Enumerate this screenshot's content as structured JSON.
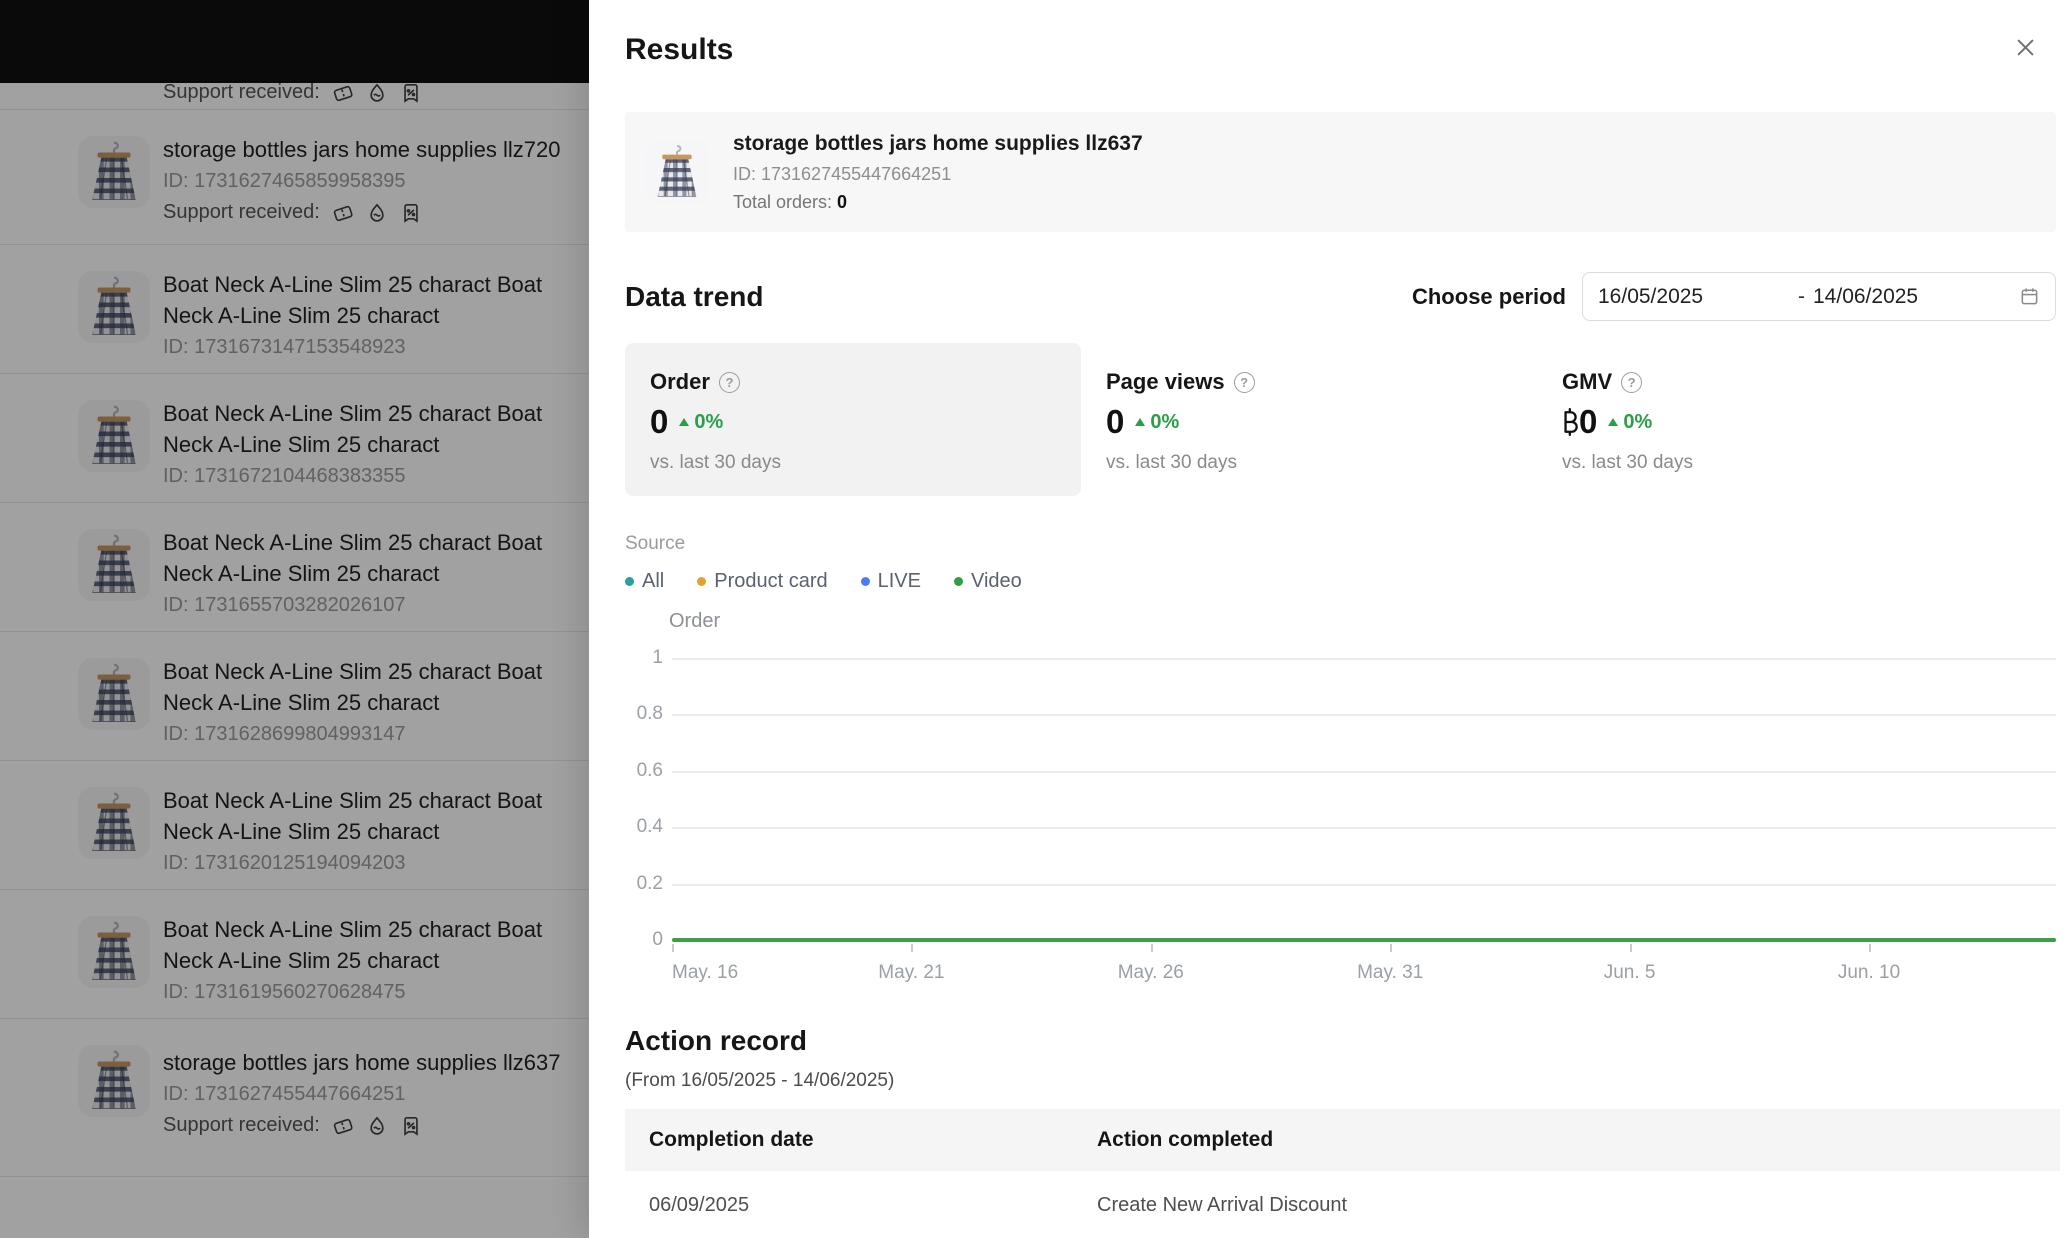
{
  "colors": {
    "accent_green": "#2b9e48",
    "chart_line_green": "#3ba049",
    "legend_all": "#2aa198",
    "legend_product_card": "#dfa32e",
    "legend_live": "#4a7df5",
    "legend_video": "#2f9e44"
  },
  "icons": {
    "close": "close-icon",
    "calendar": "calendar-icon",
    "help_glyph": "?",
    "support": [
      "voucher-icon",
      "flame-icon",
      "discount-tag-icon"
    ]
  },
  "background": {
    "products": [
      {
        "variant": "partial",
        "support_label": "Support received:"
      },
      {
        "variant": "support",
        "title": "storage bottles jars home supplies llz720",
        "id": "ID: 1731627465859958395",
        "support_label": "Support received:"
      },
      {
        "variant": "plain",
        "title": "Boat Neck A-Line Slim 25 charact Boat Neck A-Line Slim 25 charact",
        "id": "ID: 1731673147153548923"
      },
      {
        "variant": "plain",
        "title": "Boat Neck A-Line Slim 25 charact Boat Neck A-Line Slim 25 charact",
        "id": "ID: 1731672104468383355"
      },
      {
        "variant": "plain",
        "title": "Boat Neck A-Line Slim 25 charact Boat Neck A-Line Slim 25 charact",
        "id": "ID: 1731655703282026107"
      },
      {
        "variant": "plain",
        "title": "Boat Neck A-Line Slim 25 charact Boat Neck A-Line Slim 25 charact",
        "id": "ID: 1731628699804993147"
      },
      {
        "variant": "plain",
        "title": "Boat Neck A-Line Slim 25 charact Boat Neck A-Line Slim 25 charact",
        "id": "ID: 1731620125194094203"
      },
      {
        "variant": "plain",
        "title": "Boat Neck A-Line Slim 25 charact Boat Neck A-Line Slim 25 charact",
        "id": "ID: 1731619560270628475"
      },
      {
        "variant": "support-last",
        "title": "storage bottles jars home supplies llz637",
        "id": "ID: 1731627455447664251",
        "support_label": "Support received:"
      }
    ]
  },
  "modal": {
    "title": "Results",
    "product": {
      "name": "storage bottles jars home supplies llz637",
      "id_label": "ID: 1731627455447664251",
      "total_orders_label": "Total orders:",
      "total_orders_value": "0"
    },
    "data_trend": {
      "heading": "Data trend",
      "choose_period_label": "Choose period",
      "period_start": "16/05/2025",
      "period_separator": "-",
      "period_end": "14/06/2025",
      "metrics": [
        {
          "label": "Order",
          "value": "0",
          "delta": "0%",
          "compare": "vs. last 30 days",
          "selected": true
        },
        {
          "label": "Page views",
          "value": "0",
          "delta": "0%",
          "compare": "vs. last 30 days",
          "selected": false
        },
        {
          "label": "GMV",
          "currency_symbol": "฿",
          "value": "0",
          "delta": "0%",
          "compare": "vs. last 30 days",
          "selected": false
        }
      ],
      "source": {
        "label": "Source",
        "items": [
          {
            "name": "All",
            "color": "#2aa198"
          },
          {
            "name": "Product card",
            "color": "#dfa32e"
          },
          {
            "name": "LIVE",
            "color": "#4a7df5"
          },
          {
            "name": "Video",
            "color": "#2f9e44"
          }
        ]
      }
    },
    "action_record": {
      "heading": "Action record",
      "subtitle": "(From 16/05/2025 - 14/06/2025)",
      "columns": [
        "Completion date",
        "Action completed"
      ],
      "rows": [
        [
          "06/09/2025",
          "Create New Arrival Discount"
        ]
      ]
    }
  },
  "chart_data": {
    "type": "line",
    "title": "Order",
    "ylabel": "Order",
    "ylim": [
      0,
      1
    ],
    "yticks": [
      1,
      0.8,
      0.6,
      0.4,
      0.2,
      0
    ],
    "xticks": [
      "May. 16",
      "May. 21",
      "May. 26",
      "May. 31",
      "Jun. 5",
      "Jun. 10"
    ],
    "x_range": [
      "16/05/2025",
      "14/06/2025"
    ],
    "grid": true,
    "line_color": "#3ba049",
    "series": [
      {
        "name": "All",
        "values": [
          0,
          0,
          0,
          0,
          0,
          0,
          0,
          0,
          0,
          0,
          0,
          0,
          0,
          0,
          0,
          0,
          0,
          0,
          0,
          0,
          0,
          0,
          0,
          0,
          0,
          0,
          0,
          0,
          0,
          0
        ]
      },
      {
        "name": "Product card",
        "values": [
          0,
          0,
          0,
          0,
          0,
          0,
          0,
          0,
          0,
          0,
          0,
          0,
          0,
          0,
          0,
          0,
          0,
          0,
          0,
          0,
          0,
          0,
          0,
          0,
          0,
          0,
          0,
          0,
          0,
          0
        ]
      },
      {
        "name": "LIVE",
        "values": [
          0,
          0,
          0,
          0,
          0,
          0,
          0,
          0,
          0,
          0,
          0,
          0,
          0,
          0,
          0,
          0,
          0,
          0,
          0,
          0,
          0,
          0,
          0,
          0,
          0,
          0,
          0,
          0,
          0,
          0
        ]
      },
      {
        "name": "Video",
        "values": [
          0,
          0,
          0,
          0,
          0,
          0,
          0,
          0,
          0,
          0,
          0,
          0,
          0,
          0,
          0,
          0,
          0,
          0,
          0,
          0,
          0,
          0,
          0,
          0,
          0,
          0,
          0,
          0,
          0,
          0
        ]
      }
    ]
  }
}
